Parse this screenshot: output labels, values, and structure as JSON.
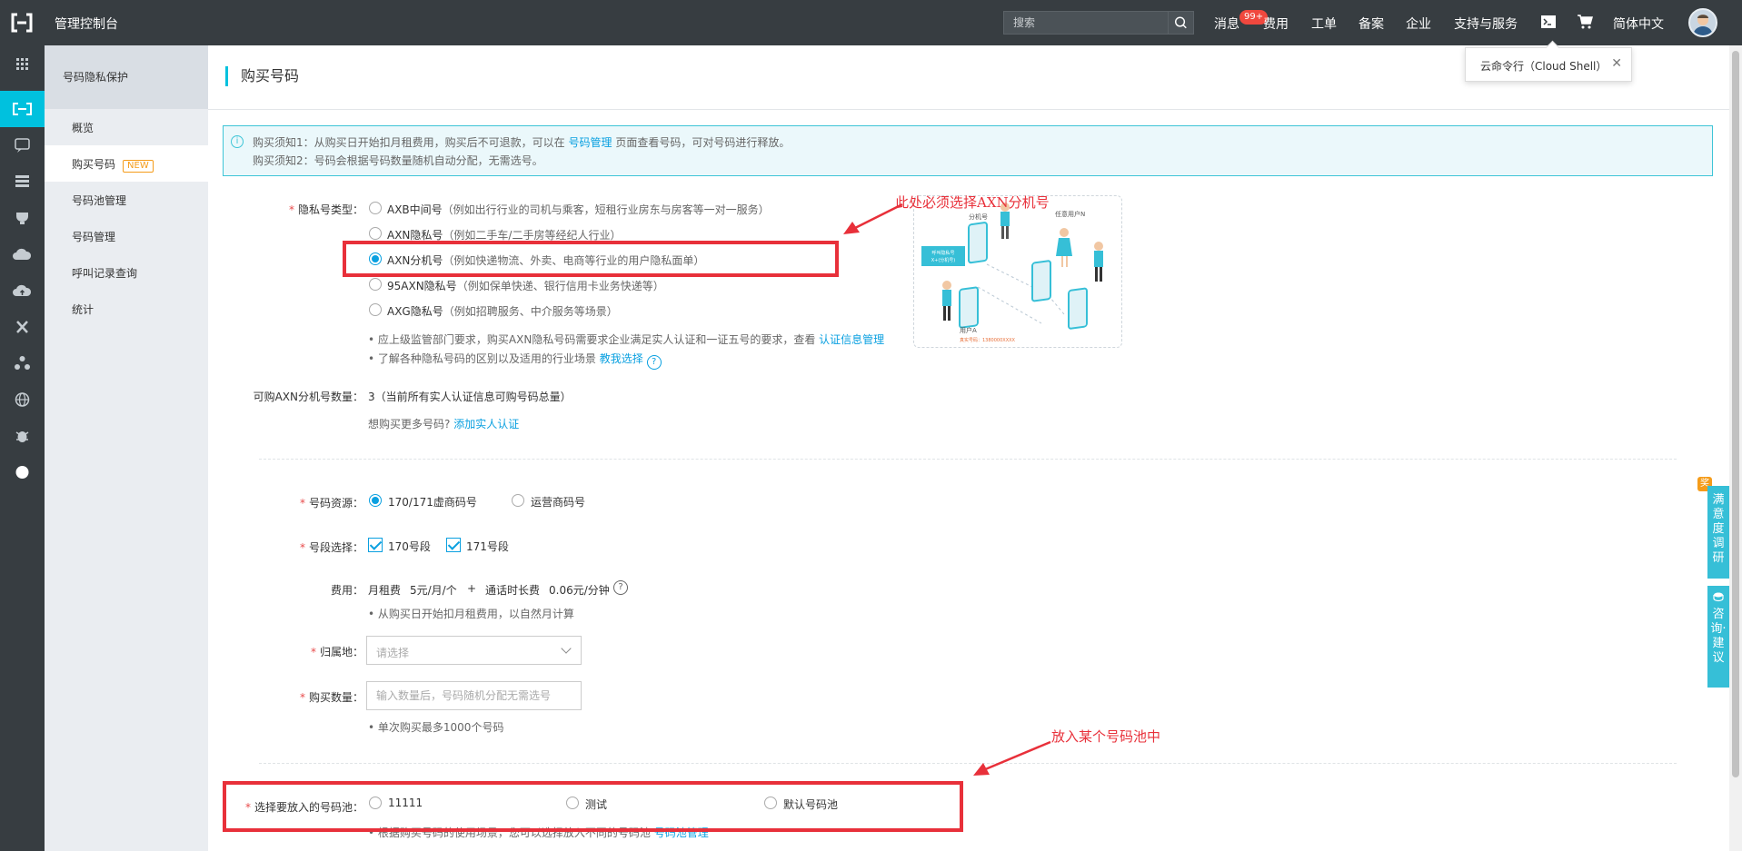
{
  "topbar": {
    "brand": "管理控制台",
    "search_placeholder": "搜索",
    "badge": "99+",
    "nav": [
      "消息",
      "费用",
      "工单",
      "备案",
      "企业",
      "支持与服务",
      "简体中文"
    ]
  },
  "tooltip": {
    "text": "云命令行（Cloud Shell）"
  },
  "sidebar": {
    "title": "号码隐私保护",
    "items": [
      {
        "label": "概览"
      },
      {
        "label": "购买号码",
        "tag": "NEW"
      },
      {
        "label": "号码池管理"
      },
      {
        "label": "号码管理"
      },
      {
        "label": "呼叫记录查询"
      },
      {
        "label": "统计"
      }
    ]
  },
  "page": {
    "title": "购买号码"
  },
  "notice": {
    "line1_pre": "购买须知1：从购买日开始扣月租费用，购买后不可退款，可以在",
    "line1_link": "号码管理",
    "line1_post": "页面查看号码，可对号码进行释放。",
    "line2": "购买须知2：号码会根据号码数量随机自动分配，无需选号。"
  },
  "privacy_type": {
    "label": "隐私号类型：",
    "options": [
      {
        "name": "AXB中间号",
        "desc": "（例如出行行业的司机与乘客，短租行业房东与房客等一对一服务）",
        "selected": false
      },
      {
        "name": "AXN隐私号",
        "desc": "（例如二手车/二手房等经纪人行业）",
        "selected": false
      },
      {
        "name": "AXN分机号",
        "desc": "（例如快递物流、外卖、电商等行业的用户隐私面单）",
        "selected": true
      },
      {
        "name": "95AXN隐私号",
        "desc": "（例如保单快递、银行信用卡业务快递等）",
        "selected": false
      },
      {
        "name": "AXG隐私号",
        "desc": "（例如招聘服务、中介服务等场景）",
        "selected": false
      }
    ],
    "hint1_pre": "应上级监管部门要求，购买AXN隐私号码需要求企业满足实人认证和一证五号的要求，查看",
    "hint1_link": "认证信息管理",
    "hint2_pre": "了解各种隐私号码的区别以及适用的行业场景",
    "hint2_link": "教我选择"
  },
  "illustration": {
    "label_top": "分机号",
    "label_right": "任意用户N",
    "label_box1": "呼叫隐私号",
    "label_box2": "X+(分机号)",
    "label_user": "用户A",
    "label_phone": "真实号码：1380000XXXX"
  },
  "available": {
    "label": "可购AXN分机号数量：",
    "value": "3（当前所有实人认证信息可购号码总量）",
    "more_pre": "想购买更多号码?",
    "more_link": "添加实人认证"
  },
  "resource": {
    "label": "号码资源：",
    "options": [
      {
        "name": "170/171虚商码号",
        "selected": true
      },
      {
        "name": "运营商码号",
        "selected": false
      }
    ]
  },
  "segment": {
    "label": "号段选择：",
    "options": [
      {
        "name": "170号段",
        "checked": true
      },
      {
        "name": "171号段",
        "checked": true
      }
    ]
  },
  "fee": {
    "label": "费用：",
    "monthly_label": "月租费",
    "monthly_value": "5元/月/个",
    "plus": "+",
    "call_label": "通话时长费",
    "call_value": "0.06元/分钟",
    "hint": "从购买日开始扣月租费用，以自然月计算"
  },
  "region": {
    "label": "归属地：",
    "placeholder": "请选择"
  },
  "quantity": {
    "label": "购买数量：",
    "placeholder": "输入数量后，号码随机分配无需选号",
    "hint": "单次购买最多1000个号码"
  },
  "pool": {
    "label": "选择要放入的号码池：",
    "options": [
      {
        "name": "11111"
      },
      {
        "name": "测试"
      },
      {
        "name": "默认号码池"
      }
    ],
    "hint_pre": "根据购买号码的使用场景，您可以选择放入不同的号码池",
    "hint_link": "号码池管理"
  },
  "annotations": {
    "note1": "此处必须选择AXN分机号",
    "note2": "放入某个号码池中"
  },
  "floating": {
    "survey": "满意度调研",
    "survey_tag": "奖",
    "consult": "咨询·建议"
  },
  "colors": {
    "accent": "#00c1de",
    "link": "#0aa0e0",
    "annotation": "#e8303a",
    "topbar": "#373d41"
  }
}
